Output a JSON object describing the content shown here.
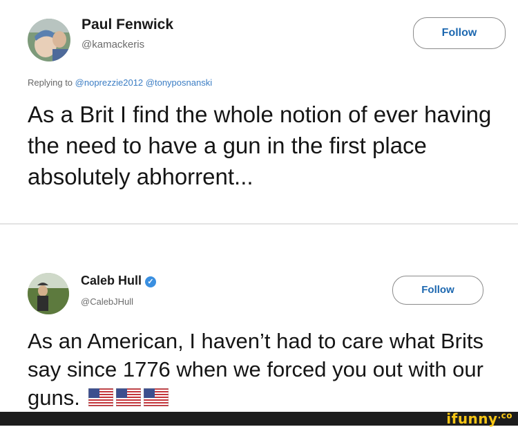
{
  "tweet1": {
    "name": "Paul Fenwick",
    "handle": "@kamackeris",
    "follow_label": "Follow",
    "reply_prefix": "Replying to",
    "mentions": [
      "@noprezzie2012",
      "@tonyposnanski"
    ],
    "text": "As a Brit I find the whole notion of ever having the need to have a gun in the first place absolutely abhorrent..."
  },
  "tweet2": {
    "name": "Caleb Hull",
    "handle": "@CalebJHull",
    "follow_label": "Follow",
    "text": "As an American, I haven’t had to care what Brits say since 1776 when we forced you out with our guns.",
    "emoji": [
      "flag-us-icon",
      "flag-us-icon",
      "flag-us-icon"
    ]
  },
  "footer": {
    "brand": "ifunny",
    "brand_suffix": ".co"
  },
  "colors": {
    "link": "#1d68b0",
    "mention": "#3b7dc4",
    "verified": "#3a8fe0",
    "brand": "#f6c515"
  }
}
